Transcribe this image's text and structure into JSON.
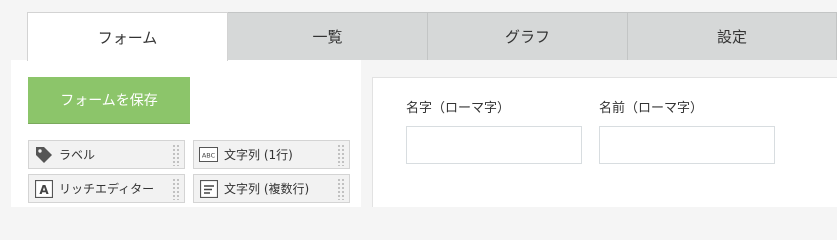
{
  "tabs": [
    {
      "label": "フォーム",
      "active": true
    },
    {
      "label": "一覧",
      "active": false
    },
    {
      "label": "グラフ",
      "active": false
    },
    {
      "label": "設定",
      "active": false
    }
  ],
  "toolbar": {
    "save_label": "フォームを保存"
  },
  "palette": {
    "items": [
      {
        "label": "ラベル",
        "icon": "tag-icon"
      },
      {
        "label": "文字列 (1行)",
        "icon": "abc-text-icon"
      },
      {
        "label": "リッチエディター",
        "icon": "rich-text-icon"
      },
      {
        "label": "文字列 (複数行)",
        "icon": "multiline-text-icon"
      }
    ]
  },
  "form": {
    "fields": [
      {
        "label": "名字（ローマ字）",
        "value": ""
      },
      {
        "label": "名前（ローマ字）",
        "value": ""
      }
    ]
  },
  "colors": {
    "accent": "#8cc56a",
    "tab_inactive": "#d6d8d8",
    "background": "#f5f5f5"
  }
}
